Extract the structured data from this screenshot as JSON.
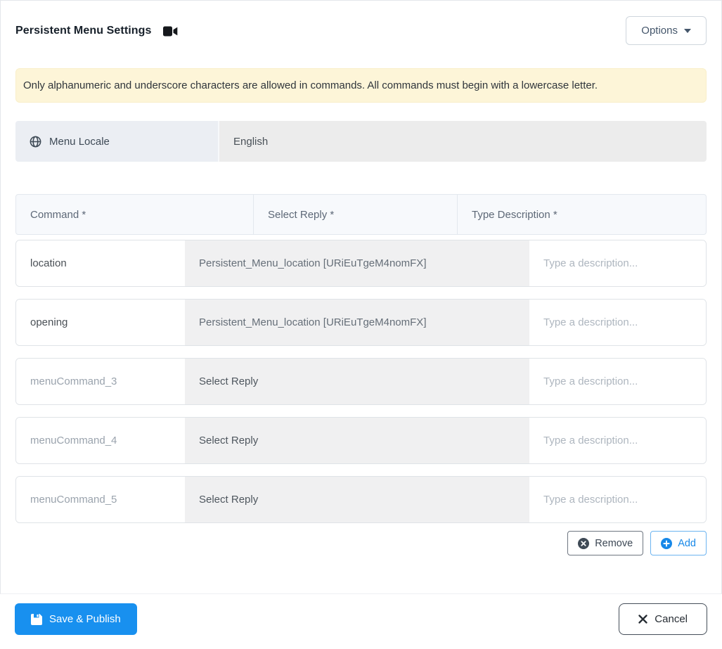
{
  "header": {
    "title": "Persistent Menu Settings",
    "options_label": "Options"
  },
  "alert": {
    "text": "Only alphanumeric and underscore characters are allowed in commands. All commands must begin with a lowercase letter."
  },
  "locale": {
    "label": "Menu Locale",
    "value": "English"
  },
  "table": {
    "headers": [
      "Command *",
      "Select Reply *",
      "Type Description *"
    ],
    "rows": [
      {
        "command": "location",
        "command_is_placeholder": false,
        "reply": "Persistent_Menu_location [URiEuTgeM4nomFX]",
        "reply_selected": true,
        "description_placeholder": "Type a description..."
      },
      {
        "command": "opening",
        "command_is_placeholder": false,
        "reply": "Persistent_Menu_location [URiEuTgeM4nomFX]",
        "reply_selected": true,
        "description_placeholder": "Type a description..."
      },
      {
        "command": "menuCommand_3",
        "command_is_placeholder": true,
        "reply": "Select Reply",
        "reply_selected": false,
        "description_placeholder": "Type a description..."
      },
      {
        "command": "menuCommand_4",
        "command_is_placeholder": true,
        "reply": "Select Reply",
        "reply_selected": false,
        "description_placeholder": "Type a description..."
      },
      {
        "command": "menuCommand_5",
        "command_is_placeholder": true,
        "reply": "Select Reply",
        "reply_selected": false,
        "description_placeholder": "Type a description..."
      }
    ],
    "remove_label": "Remove",
    "add_label": "Add"
  },
  "footer": {
    "save_label": "Save & Publish",
    "cancel_label": "Cancel"
  },
  "colors": {
    "primary_blue": "#1890ef",
    "alert_bg": "#fdf5d8",
    "header_bg": "#f7f9fc",
    "reply_bg": "#f0f0f1",
    "locale_label_bg": "#ebeef3",
    "locale_value_bg": "#ececec",
    "dark_text": "#3e4a56"
  }
}
